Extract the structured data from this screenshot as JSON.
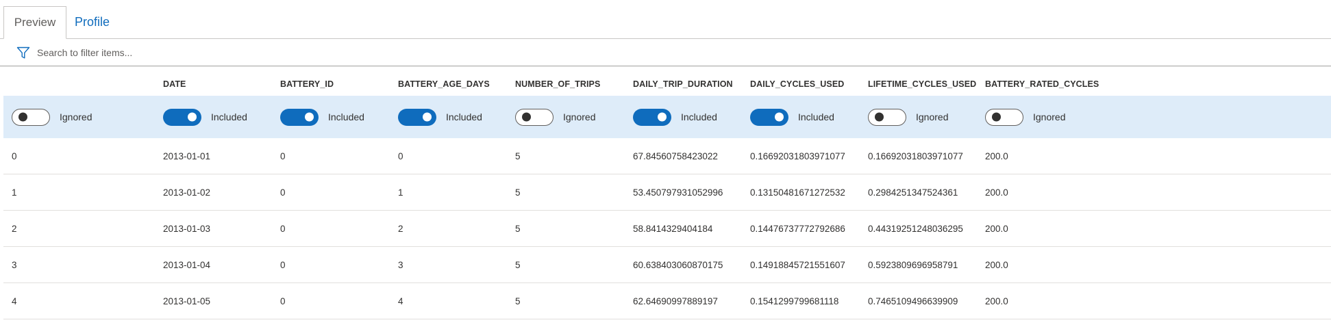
{
  "tabs": [
    {
      "label": "Preview",
      "active": true
    },
    {
      "label": "Profile",
      "active": false
    }
  ],
  "filter": {
    "placeholder": "Search to filter items...",
    "icon": "filter-icon",
    "value": ""
  },
  "columns": [
    "",
    "DATE",
    "BATTERY_ID",
    "BATTERY_AGE_DAYS",
    "NUMBER_OF_TRIPS",
    "DAILY_TRIP_DURATION",
    "DAILY_CYCLES_USED",
    "LIFETIME_CYCLES_USED",
    "BATTERY_RATED_CYCLES"
  ],
  "toggles": [
    {
      "state": "off",
      "label": "Ignored"
    },
    {
      "state": "on",
      "label": "Included"
    },
    {
      "state": "on",
      "label": "Included"
    },
    {
      "state": "on",
      "label": "Included"
    },
    {
      "state": "off",
      "label": "Ignored"
    },
    {
      "state": "on",
      "label": "Included"
    },
    {
      "state": "on",
      "label": "Included"
    },
    {
      "state": "off",
      "label": "Ignored"
    },
    {
      "state": "off",
      "label": "Ignored"
    }
  ],
  "rows": [
    [
      "0",
      "2013-01-01",
      "0",
      "0",
      "5",
      "67.84560758423022",
      "0.16692031803971077",
      "0.16692031803971077",
      "200.0"
    ],
    [
      "1",
      "2013-01-02",
      "0",
      "1",
      "5",
      "53.450797931052996",
      "0.13150481671272532",
      "0.2984251347524361",
      "200.0"
    ],
    [
      "2",
      "2013-01-03",
      "0",
      "2",
      "5",
      "58.8414329404184",
      "0.14476737772792686",
      "0.44319251248036295",
      "200.0"
    ],
    [
      "3",
      "2013-01-04",
      "0",
      "3",
      "5",
      "60.638403060870175",
      "0.14918845721551607",
      "0.5923809696958791",
      "200.0"
    ],
    [
      "4",
      "2013-01-05",
      "0",
      "4",
      "5",
      "62.64690997889197",
      "0.1541299799681118",
      "0.7465109496639909",
      "200.0"
    ]
  ],
  "colors": {
    "accent": "#0f6cbd",
    "selected_row": "#deecf9"
  }
}
